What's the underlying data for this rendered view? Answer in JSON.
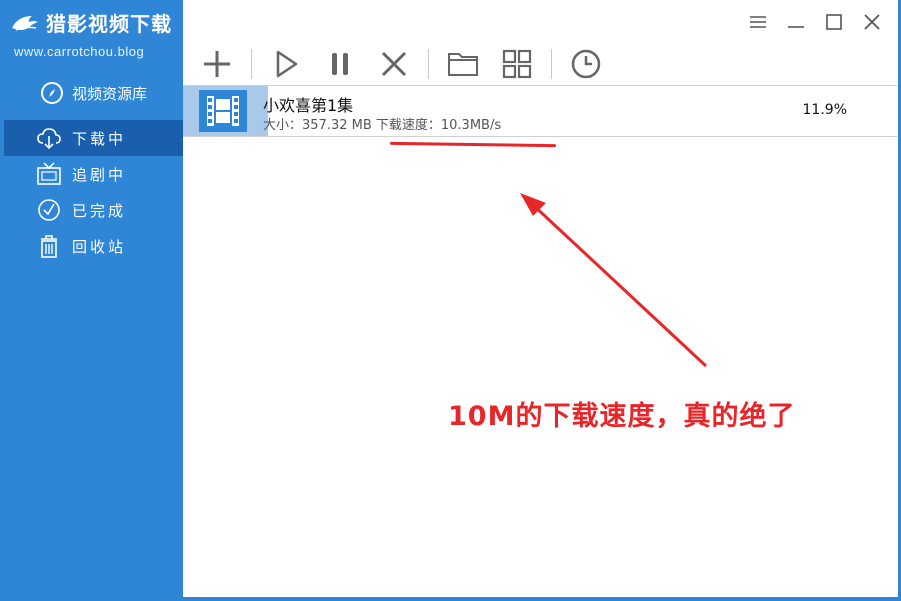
{
  "app": {
    "title": "猎影视频下载",
    "url": "www.carrotchou.blog"
  },
  "sidebar": {
    "library_label": "视频资源库",
    "items": [
      {
        "label": "下载中",
        "icon": "cloud-download-icon",
        "active": true
      },
      {
        "label": "追剧中",
        "icon": "tv-icon",
        "active": false
      },
      {
        "label": "已完成",
        "icon": "check-circle-icon",
        "active": false
      },
      {
        "label": "回收站",
        "icon": "trash-icon",
        "active": false
      }
    ]
  },
  "toolbar": {
    "buttons": [
      "add-icon",
      "play-icon",
      "pause-icon",
      "delete-icon",
      "folder-icon",
      "grid-icon",
      "clock-icon"
    ]
  },
  "window_controls": [
    "menu-icon",
    "minimize-icon",
    "maximize-icon",
    "close-icon"
  ],
  "downloads": [
    {
      "title": "小欢喜第1集",
      "meta": "大小：357.32 MB 下载速度：10.3MB/s",
      "progress_percent": 11.9,
      "progress_text": "11.9%"
    }
  ],
  "annotation": {
    "text": "10M的下载速度，真的绝了",
    "color": "#e8262a"
  },
  "colors": {
    "sidebar": "#2f86d6",
    "sidebar_active": "#1a5fae",
    "progress_fill": "#a9c9ea"
  }
}
